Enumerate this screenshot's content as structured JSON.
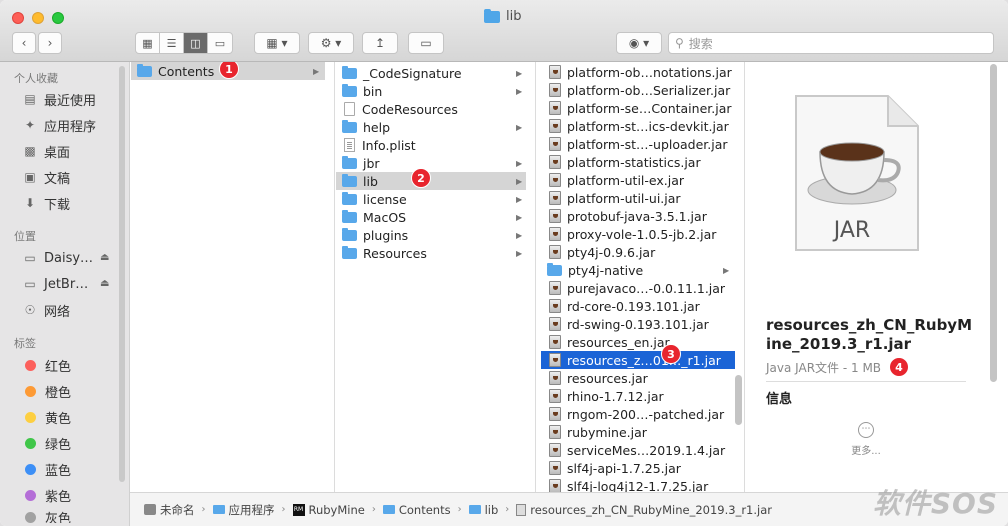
{
  "window": {
    "title": "lib"
  },
  "toolbar": {
    "back_icon": "chevron-left",
    "forward_icon": "chevron-right",
    "view_modes": [
      "icon-view",
      "list-view",
      "column-view",
      "gallery-view"
    ],
    "active_view": "column-view",
    "search_placeholder": "搜索"
  },
  "sidebar": {
    "favorites_header": "个人收藏",
    "favorites": [
      {
        "label": "最近使用",
        "icon": "clock-icon"
      },
      {
        "label": "应用程序",
        "icon": "applications-icon"
      },
      {
        "label": "桌面",
        "icon": "desktop-icon"
      },
      {
        "label": "文稿",
        "icon": "document-icon"
      },
      {
        "label": "下载",
        "icon": "download-icon"
      }
    ],
    "locations_header": "位置",
    "locations": [
      {
        "label": "Daisy…",
        "icon": "disk-icon"
      },
      {
        "label": "JetBr…",
        "icon": "disk-icon"
      },
      {
        "label": "网络",
        "icon": "network-icon"
      }
    ],
    "tags_header": "标签",
    "tags": [
      {
        "label": "红色",
        "color": "#fc605c"
      },
      {
        "label": "橙色",
        "color": "#fd9a35"
      },
      {
        "label": "黄色",
        "color": "#fdcf41"
      },
      {
        "label": "绿色",
        "color": "#40c649"
      },
      {
        "label": "蓝色",
        "color": "#3d8ff6"
      },
      {
        "label": "紫色",
        "color": "#b46ed7"
      },
      {
        "label": "灰色",
        "color": "#a1a1a1"
      }
    ]
  },
  "columns": {
    "col1": [
      {
        "label": "Contents",
        "type": "folder",
        "selected": true
      }
    ],
    "col2": [
      {
        "label": "_CodeSignature",
        "type": "folder"
      },
      {
        "label": "bin",
        "type": "folder"
      },
      {
        "label": "CodeResources",
        "type": "doc"
      },
      {
        "label": "help",
        "type": "folder"
      },
      {
        "label": "Info.plist",
        "type": "plist"
      },
      {
        "label": "jbr",
        "type": "folder"
      },
      {
        "label": "lib",
        "type": "folder",
        "selected": true
      },
      {
        "label": "license",
        "type": "folder"
      },
      {
        "label": "MacOS",
        "type": "folder"
      },
      {
        "label": "plugins",
        "type": "folder"
      },
      {
        "label": "Resources",
        "type": "folder"
      }
    ],
    "col3": [
      "platform-ob…notations.jar",
      "platform-ob…Serializer.jar",
      "platform-se…Container.jar",
      "platform-st…ics-devkit.jar",
      "platform-st…-uploader.jar",
      "platform-statistics.jar",
      "platform-util-ex.jar",
      "platform-util-ui.jar",
      "protobuf-java-3.5.1.jar",
      "proxy-vole-1.0.5-jb.2.jar",
      "pty4j-0.9.6.jar",
      "pty4j-native",
      "purejavaco…-0.0.11.1.jar",
      "rd-core-0.193.101.jar",
      "rd-swing-0.193.101.jar",
      "resources_en.jar",
      "resources_z…01…_r1.jar",
      "resources.jar",
      "rhino-1.7.12.jar",
      "rngom-200…-patched.jar",
      "rubymine.jar",
      "serviceMes…2019.1.4.jar",
      "slf4j-api-1.7.25.jar",
      "slf4j-log4j12-1.7.25.jar"
    ],
    "col3_folder_index": 11,
    "col3_active_index": 16
  },
  "badges": [
    "1",
    "2",
    "3",
    "4"
  ],
  "preview": {
    "icon_label": "JAR",
    "filename": "resources_zh_CN_RubyMine_2019.3_r1.jar",
    "meta": "Java JAR文件 - 1 MB",
    "info_header": "信息",
    "more_label": "更多..."
  },
  "pathbar": [
    "未命名",
    "应用程序",
    "RubyMine",
    "Contents",
    "lib",
    "resources_zh_CN_RubyMine_2019.3_r1.jar"
  ],
  "watermark": "软件SOS"
}
